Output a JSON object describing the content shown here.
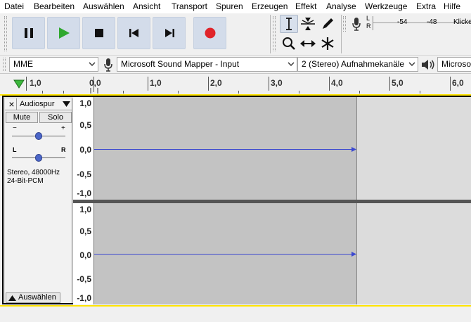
{
  "menu": [
    "Datei",
    "Bearbeiten",
    "Auswählen",
    "Ansicht",
    "Transport",
    "Spuren",
    "Erzeugen",
    "Effekt",
    "Analyse",
    "Werkzeuge",
    "Extra",
    "Hilfe"
  ],
  "meter": {
    "scale": [
      "-54",
      "-48"
    ],
    "prompt": "Klicke",
    "channels": [
      "L",
      "R"
    ]
  },
  "device": {
    "host": "MME",
    "input": "Microsoft Sound Mapper - Input",
    "channels": "2 (Stereo) Aufnahmekanäle",
    "output": "Microso"
  },
  "ruler": {
    "labels": [
      "1,0",
      "0,0",
      "1,0",
      "2,0",
      "3,0",
      "4,0",
      "5,0",
      "6,0"
    ]
  },
  "track": {
    "name": "Audiospur",
    "mute": "Mute",
    "solo": "Solo",
    "gain_minus": "−",
    "gain_plus": "+",
    "pan_left": "L",
    "pan_right": "R",
    "info_line1": "Stereo, 48000Hz",
    "info_line2": "24-Bit-PCM",
    "select_label": "Auswählen",
    "close": "×",
    "scale": [
      "1,0",
      "0,5",
      "0,0",
      "-0,5",
      "-1,0"
    ]
  },
  "colors": {
    "selection": "#c3c3c3",
    "waveform_bg": "#dcdcdc",
    "waveform_line": "#3b48d0",
    "record": "#e0242a",
    "play": "#2fa82f",
    "button_bg": "#d3dcea",
    "focus_outline": "#ffe400"
  }
}
